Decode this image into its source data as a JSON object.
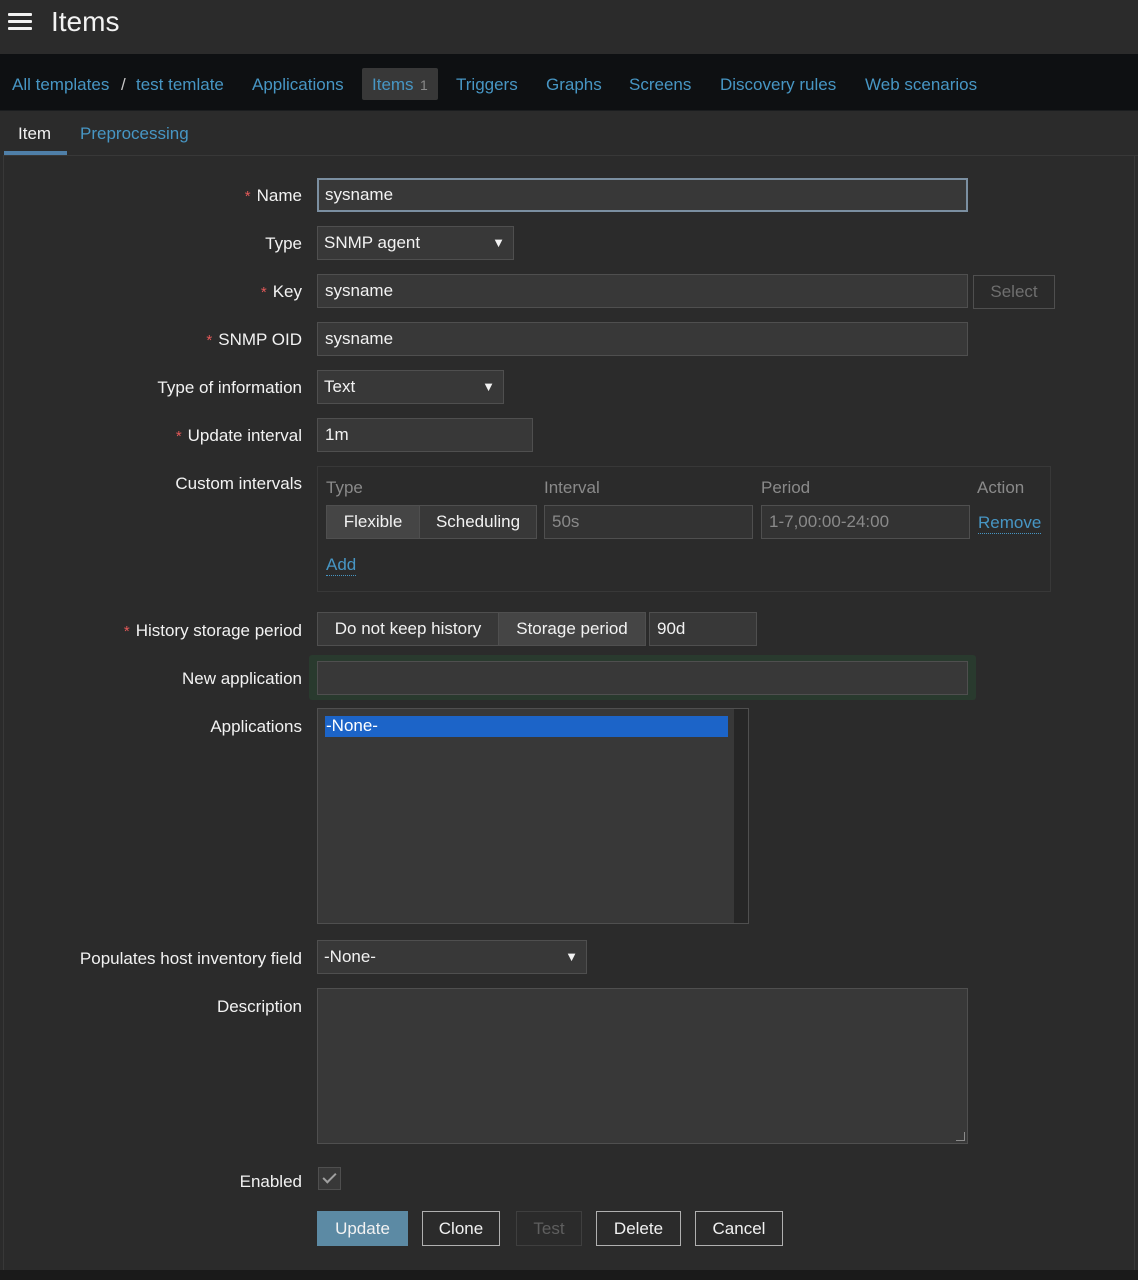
{
  "header": {
    "title": "Items"
  },
  "nav": {
    "all_templates": "All templates",
    "sep": "/",
    "template": "test temlate",
    "applications": "Applications",
    "items": "Items",
    "items_count": "1",
    "triggers": "Triggers",
    "graphs": "Graphs",
    "screens": "Screens",
    "discovery_rules": "Discovery rules",
    "web_scenarios": "Web scenarios"
  },
  "tabs": {
    "item": "Item",
    "preprocessing": "Preprocessing"
  },
  "form": {
    "required_mark": "*",
    "name": {
      "label": "Name",
      "value": "sysname"
    },
    "type": {
      "label": "Type",
      "value": "SNMP agent"
    },
    "key": {
      "label": "Key",
      "value": "sysname",
      "select_button": "Select"
    },
    "snmp_oid": {
      "label": "SNMP OID",
      "value": "sysname"
    },
    "type_of_information": {
      "label": "Type of information",
      "value": "Text"
    },
    "update_interval": {
      "label": "Update interval",
      "value": "1m"
    },
    "custom_intervals": {
      "label": "Custom intervals",
      "columns": {
        "type": "Type",
        "interval": "Interval",
        "period": "Period",
        "action": "Action"
      },
      "row": {
        "flexible": "Flexible",
        "scheduling": "Scheduling",
        "interval": "50s",
        "period": "1-7,00:00-24:00",
        "remove": "Remove"
      },
      "add": "Add"
    },
    "history": {
      "label": "History storage period",
      "no_keep": "Do not keep history",
      "storage": "Storage period",
      "value": "90d"
    },
    "new_application": {
      "label": "New application",
      "value": ""
    },
    "applications": {
      "label": "Applications",
      "options": [
        "-None-"
      ]
    },
    "inventory": {
      "label": "Populates host inventory field",
      "value": "-None-"
    },
    "description": {
      "label": "Description",
      "value": ""
    },
    "enabled": {
      "label": "Enabled",
      "checked": true
    }
  },
  "buttons": {
    "update": "Update",
    "clone": "Clone",
    "test": "Test",
    "delete": "Delete",
    "cancel": "Cancel"
  },
  "icons": {
    "menu": "hamburger-menu-icon",
    "dropdown": "chevron-down-icon",
    "check": "checkmark-icon"
  },
  "colors": {
    "link": "#4796c4",
    "required": "#e45959",
    "selection": "#1c64c8",
    "primary_button": "#5c8aa4"
  }
}
